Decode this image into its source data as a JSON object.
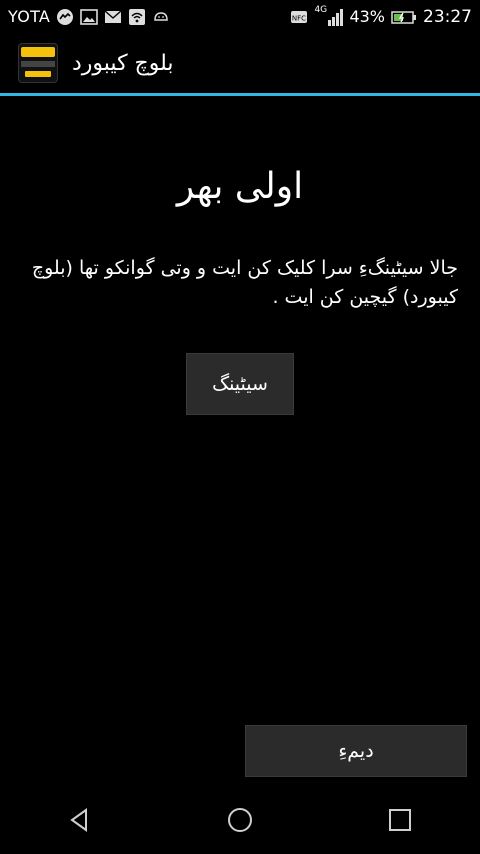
{
  "status_bar": {
    "carrier": "YOTA",
    "network": "4G",
    "battery": "43%",
    "time": "23:27"
  },
  "action_bar": {
    "title": "بلوچ کیبورد"
  },
  "main": {
    "heading": "اولی بهر",
    "instruction": "جالا سیٹینگءِ سرا کلیک کن ایت و وتی گوانکو تها (بلوچ کیبورد) گیچین کن ایت .",
    "settings_button": "سیٹینگ",
    "next_button": "دیمءِ"
  },
  "nav_bar": {
    "back": "back-icon",
    "home": "home-icon",
    "recents": "recents-icon"
  }
}
